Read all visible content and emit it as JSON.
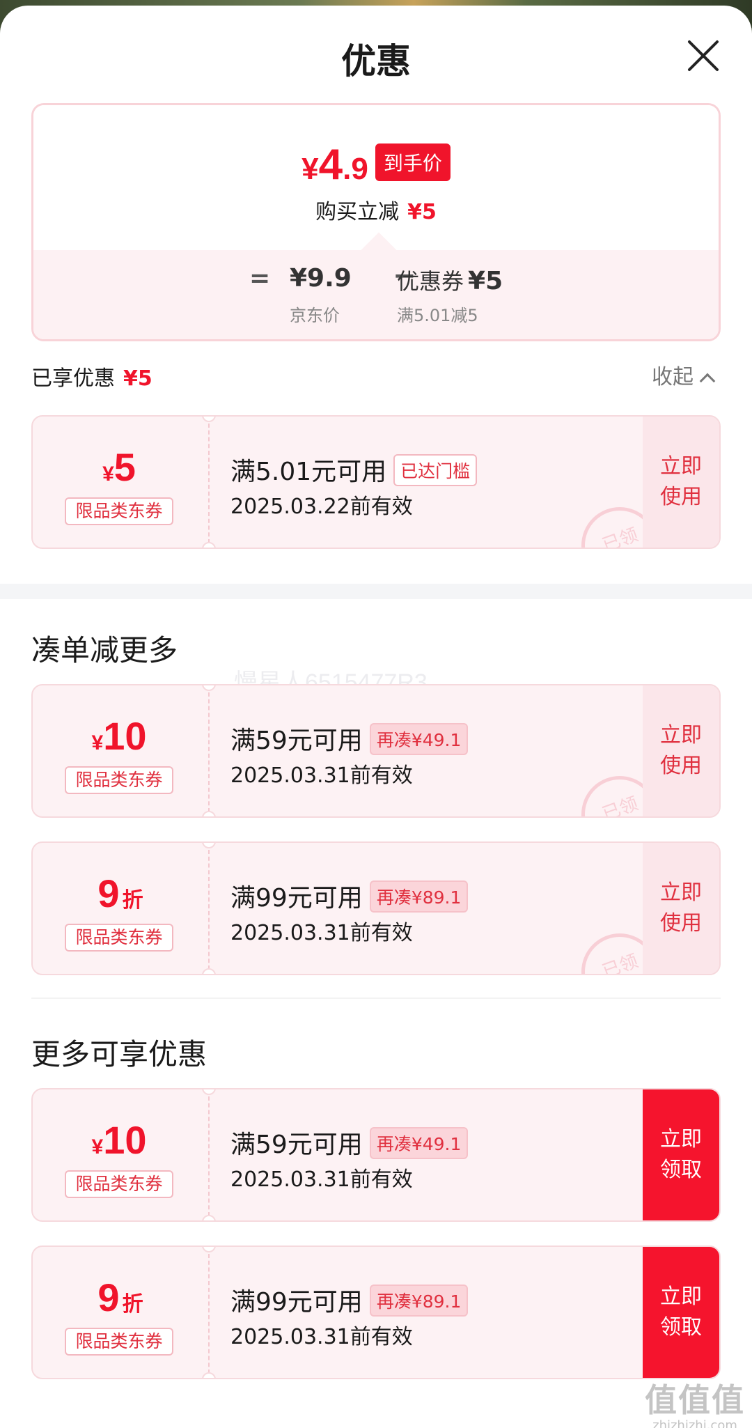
{
  "header": {
    "title": "优惠"
  },
  "summary": {
    "final_currency": "¥",
    "final_int": "4",
    "final_dec": ".9",
    "final_tag": "到手价",
    "reduce_label": "购买立减",
    "reduce_amount": "¥5",
    "eq": "=",
    "jd_price": "¥9.9",
    "jd_price_label": "京东价",
    "minus": "−",
    "coupon_label": "优惠券",
    "coupon_amount": "¥5",
    "coupon_rule": "满5.01减5"
  },
  "enjoyed": {
    "label": "已享优惠",
    "amount": "¥5",
    "collapse": "收起"
  },
  "sections": {
    "combine": "凑单减更多",
    "more": "更多可享优惠"
  },
  "watermark": "慢星人6515477R3",
  "site_mark": {
    "big": "值值值",
    "small": "zhizhizhi.com"
  },
  "coupons": [
    {
      "currency": "¥",
      "num": "5",
      "unit": "",
      "category": "限品类东券",
      "condition": "满5.01元可用",
      "badge": "已达门槛",
      "badge_style": "outline",
      "valid": "2025.03.22前有效",
      "action": "立即\n使用",
      "stamp": "已领",
      "action_style": "light"
    },
    {
      "currency": "¥",
      "num": "10",
      "unit": "",
      "category": "限品类东券",
      "condition": "满59元可用",
      "badge": "再凑¥49.1",
      "badge_style": "fill",
      "valid": "2025.03.31前有效",
      "action": "立即\n使用",
      "stamp": "已领",
      "action_style": "light"
    },
    {
      "currency": "",
      "num": "9",
      "unit": "折",
      "category": "限品类东券",
      "condition": "满99元可用",
      "badge": "再凑¥89.1",
      "badge_style": "fill",
      "valid": "2025.03.31前有效",
      "action": "立即\n使用",
      "stamp": "已领",
      "action_style": "light"
    },
    {
      "currency": "¥",
      "num": "10",
      "unit": "",
      "category": "限品类东券",
      "condition": "满59元可用",
      "badge": "再凑¥49.1",
      "badge_style": "fill",
      "valid": "2025.03.31前有效",
      "action": "立即\n领取",
      "stamp": "",
      "action_style": "solid"
    },
    {
      "currency": "",
      "num": "9",
      "unit": "折",
      "category": "限品类东券",
      "condition": "满99元可用",
      "badge": "再凑¥89.1",
      "badge_style": "fill",
      "valid": "2025.03.31前有效",
      "action": "立即\n领取",
      "stamp": "",
      "action_style": "solid"
    }
  ]
}
